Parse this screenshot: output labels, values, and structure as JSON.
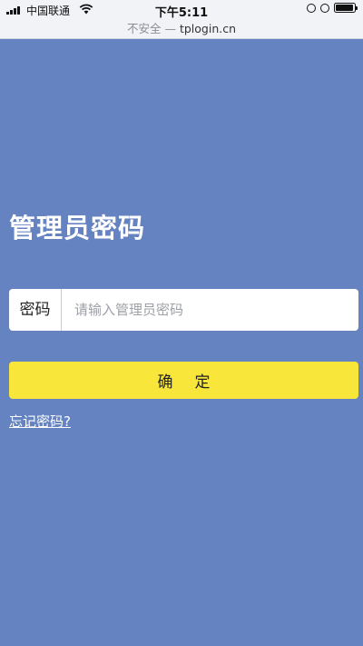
{
  "status_bar": {
    "carrier": "中国联通",
    "time": "下午5:11",
    "battery_level": 0.95
  },
  "url_bar": {
    "security_label": "不安全 —",
    "host": "tplogin.cn"
  },
  "login": {
    "title": "管理员密码",
    "password_label": "密码",
    "password_placeholder": "请输入管理员密码",
    "password_value": "",
    "confirm_label": "确定",
    "forgot_link": "忘记密码?"
  },
  "colors": {
    "background": "#6583c1",
    "button": "#f8e63b",
    "input_bg": "#ffffff"
  }
}
